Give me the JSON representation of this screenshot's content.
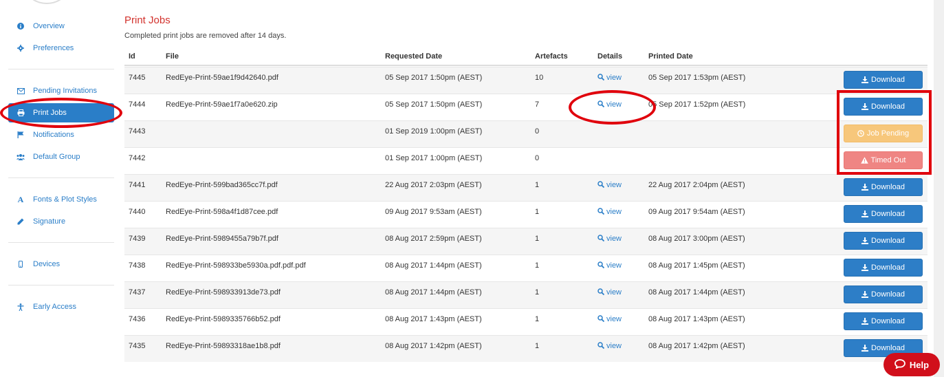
{
  "sidebar": {
    "items": [
      {
        "label": "Overview",
        "icon": "info-circle-icon"
      },
      {
        "label": "Preferences",
        "icon": "gear-icon"
      },
      {
        "label": "Pending Invitations",
        "icon": "envelope-icon"
      },
      {
        "label": "Print Jobs",
        "icon": "printer-icon"
      },
      {
        "label": "Notifications",
        "icon": "flag-icon"
      },
      {
        "label": "Default Group",
        "icon": "users-icon"
      },
      {
        "label": "Fonts & Plot Styles",
        "icon": "font-icon"
      },
      {
        "label": "Signature",
        "icon": "pencil-icon"
      },
      {
        "label": "Devices",
        "icon": "mobile-icon"
      },
      {
        "label": "Early Access",
        "icon": "accessibility-icon"
      }
    ]
  },
  "main": {
    "title": "Print Jobs",
    "subtitle": "Completed print jobs are removed after 14 days.",
    "columns": {
      "id": "Id",
      "file": "File",
      "requested": "Requested Date",
      "artefacts": "Artefacts",
      "details": "Details",
      "printed": "Printed Date"
    },
    "rows": [
      {
        "id": "7445",
        "file": "RedEye-Print-59ae1f9d42640.pdf",
        "requested": "05 Sep 2017 1:50pm (AEST)",
        "artefacts": "10",
        "details": "view",
        "printed": "05 Sep 2017 1:53pm (AEST)",
        "action": "Download",
        "status": "download"
      },
      {
        "id": "7444",
        "file": "RedEye-Print-59ae1f7a0e620.zip",
        "requested": "05 Sep 2017 1:50pm (AEST)",
        "artefacts": "7",
        "details": "view",
        "printed": "05 Sep 2017 1:52pm (AEST)",
        "action": "Download",
        "status": "download"
      },
      {
        "id": "7443",
        "file": "",
        "requested": "01 Sep 2019 1:00pm (AEST)",
        "artefacts": "0",
        "details": "",
        "printed": "",
        "action": "Job Pending",
        "status": "pending"
      },
      {
        "id": "7442",
        "file": "",
        "requested": "01 Sep 2017 1:00pm (AEST)",
        "artefacts": "0",
        "details": "",
        "printed": "",
        "action": "Timed Out",
        "status": "timeout"
      },
      {
        "id": "7441",
        "file": "RedEye-Print-599bad365cc7f.pdf",
        "requested": "22 Aug 2017 2:03pm (AEST)",
        "artefacts": "1",
        "details": "view",
        "printed": "22 Aug 2017 2:04pm (AEST)",
        "action": "Download",
        "status": "download"
      },
      {
        "id": "7440",
        "file": "RedEye-Print-598a4f1d87cee.pdf",
        "requested": "09 Aug 2017 9:53am (AEST)",
        "artefacts": "1",
        "details": "view",
        "printed": "09 Aug 2017 9:54am (AEST)",
        "action": "Download",
        "status": "download"
      },
      {
        "id": "7439",
        "file": "RedEye-Print-5989455a79b7f.pdf",
        "requested": "08 Aug 2017 2:59pm (AEST)",
        "artefacts": "1",
        "details": "view",
        "printed": "08 Aug 2017 3:00pm (AEST)",
        "action": "Download",
        "status": "download"
      },
      {
        "id": "7438",
        "file": "RedEye-Print-598933be5930a.pdf.pdf.pdf",
        "requested": "08 Aug 2017 1:44pm (AEST)",
        "artefacts": "1",
        "details": "view",
        "printed": "08 Aug 2017 1:45pm (AEST)",
        "action": "Download",
        "status": "download"
      },
      {
        "id": "7437",
        "file": "RedEye-Print-598933913de73.pdf",
        "requested": "08 Aug 2017 1:44pm (AEST)",
        "artefacts": "1",
        "details": "view",
        "printed": "08 Aug 2017 1:44pm (AEST)",
        "action": "Download",
        "status": "download"
      },
      {
        "id": "7436",
        "file": "RedEye-Print-5989335766b52.pdf",
        "requested": "08 Aug 2017 1:43pm (AEST)",
        "artefacts": "1",
        "details": "view",
        "printed": "08 Aug 2017 1:43pm (AEST)",
        "action": "Download",
        "status": "download"
      },
      {
        "id": "7435",
        "file": "RedEye-Print-59893318ae1b8.pdf",
        "requested": "08 Aug 2017 1:42pm (AEST)",
        "artefacts": "1",
        "details": "view",
        "printed": "08 Aug 2017 1:42pm (AEST)",
        "action": "Download",
        "status": "download"
      }
    ]
  },
  "help": {
    "label": "Help",
    "icon": "chat-bubble-icon"
  },
  "colors": {
    "accent": "#2a7ec8",
    "title": "#d2322d",
    "download": "#2d7ec7",
    "pending": "#f7c77b",
    "timeout": "#ef8583",
    "annotation": "#e0000c",
    "help": "#d10f1b"
  }
}
